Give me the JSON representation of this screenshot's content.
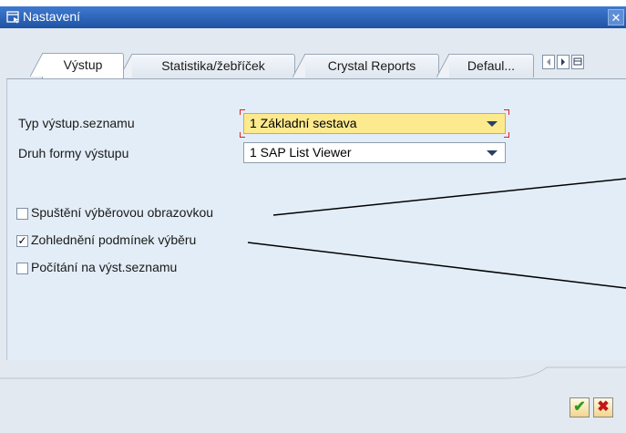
{
  "window": {
    "title": "Nastavení"
  },
  "tabs": [
    {
      "label": "Výstup",
      "active": true
    },
    {
      "label": "Statistika/žebříček",
      "active": false
    },
    {
      "label": "Crystal Reports",
      "active": false
    },
    {
      "label": "Defaul...",
      "active": false
    }
  ],
  "tab_nav": {
    "prev_icon": "arrow-left-icon",
    "next_icon": "arrow-right-icon",
    "list_icon": "tab-list-icon"
  },
  "fields": {
    "output_list_type": {
      "label": "Typ výstup.seznamu",
      "value": "1 Základní sestava",
      "required": true
    },
    "output_form_type": {
      "label": "Druh formy výstupu",
      "value": "1 SAP List Viewer",
      "required": false
    }
  },
  "checkboxes": [
    {
      "label": "Spuštění výběrovou obrazovkou",
      "checked": false,
      "mark": ""
    },
    {
      "label": "Zohlednění podmínek výběru",
      "checked": true,
      "mark": "✓"
    },
    {
      "label": "Počítání na výst.seznamu",
      "checked": false,
      "mark": ""
    }
  ],
  "buttons": {
    "ok_icon": "checkmark-icon",
    "cancel_icon": "cancel-x-icon",
    "ok_glyph": "✔",
    "cancel_glyph": "✖",
    "close_glyph": "✕"
  },
  "colors": {
    "title_bar": "#2b5fb0",
    "panel_bg": "#e3edf7",
    "required_field_bg": "#fdea8e",
    "ok_green": "#2e9b1f",
    "cancel_red": "#c21818"
  }
}
